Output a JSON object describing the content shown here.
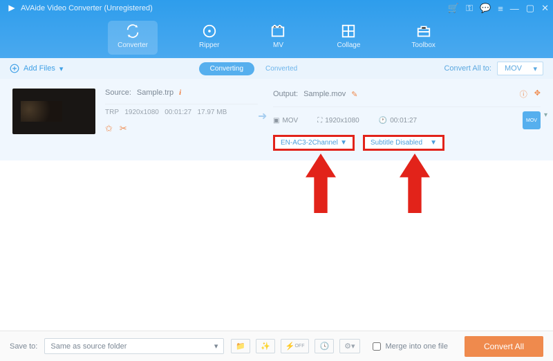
{
  "app": {
    "title": "AVAide Video Converter (Unregistered)"
  },
  "nav": {
    "converter": "Converter",
    "ripper": "Ripper",
    "mv": "MV",
    "collage": "Collage",
    "toolbox": "Toolbox"
  },
  "subbar": {
    "add_files": "Add Files",
    "converting": "Converting",
    "converted": "Converted",
    "convert_all_to": "Convert All to:",
    "format": "MOV"
  },
  "file": {
    "source_label": "Source:",
    "source_name": "Sample.trp",
    "src_fmt": "TRP",
    "src_res": "1920x1080",
    "src_dur": "00:01:27",
    "src_size": "17.97 MB",
    "output_label": "Output:",
    "output_name": "Sample.mov",
    "out_fmt": "MOV",
    "out_res": "1920x1080",
    "out_dur": "00:01:27",
    "audio_select": "EN-AC3-2Channel",
    "subtitle_select": "Subtitle Disabled",
    "badge": "MOV"
  },
  "footer": {
    "saveto_label": "Save to:",
    "saveto_value": "Same as source folder",
    "merge_label": "Merge into one file",
    "convert_all": "Convert All"
  }
}
